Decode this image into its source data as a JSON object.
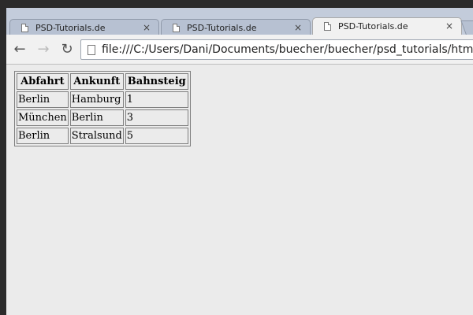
{
  "tabs": [
    {
      "title": "PSD-Tutorials.de",
      "close": "×",
      "active": false
    },
    {
      "title": "PSD-Tutorials.de",
      "close": "×",
      "active": false
    },
    {
      "title": "PSD-Tutorials.de",
      "close": "×",
      "active": true
    }
  ],
  "toolbar": {
    "back": "←",
    "forward": "→",
    "reload": "↻",
    "url": "file:///C:/Users/Dani/Documents/buecher/buecher/psd_tutorials/html"
  },
  "table": {
    "headers": [
      "Abfahrt",
      "Ankunft",
      "Bahnsteig"
    ],
    "rows": [
      [
        "Berlin",
        "Hamburg",
        "1"
      ],
      [
        "München",
        "Berlin",
        "3"
      ],
      [
        "Berlin",
        "Stralsund",
        "5"
      ]
    ]
  }
}
